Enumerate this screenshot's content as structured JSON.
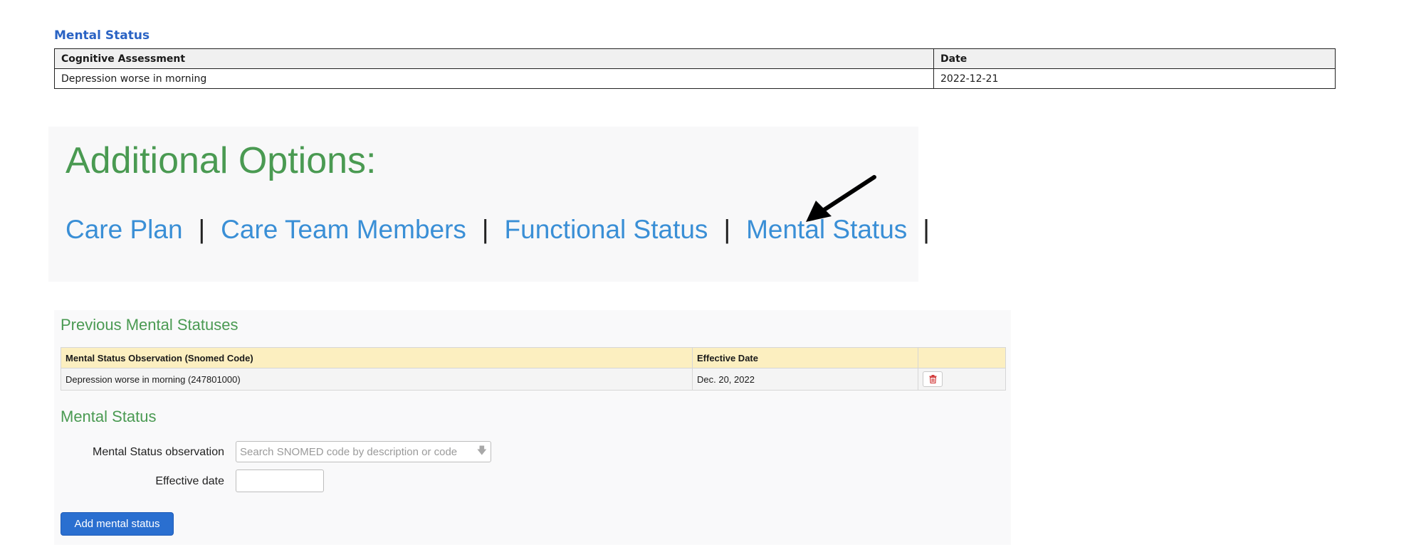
{
  "summary": {
    "title": "Mental Status",
    "headers": [
      "Cognitive Assessment",
      "Date"
    ],
    "rows": [
      [
        "Depression worse in morning",
        "2022-12-21"
      ]
    ]
  },
  "options": {
    "heading": "Additional Options:",
    "links": [
      "Care Plan",
      "Care Team Members",
      "Functional Status",
      "Mental Status"
    ],
    "separator": "|"
  },
  "previous": {
    "heading": "Previous Mental Statuses",
    "headers": [
      "Mental Status Observation (Snomed Code)",
      "Effective Date",
      ""
    ],
    "rows": [
      {
        "observation": "Depression worse in morning (247801000)",
        "date": "Dec. 20, 2022",
        "action_icon": "trash-icon"
      }
    ]
  },
  "form": {
    "heading": "Mental Status",
    "observation_label": "Mental Status observation",
    "observation_placeholder": "Search SNOMED code by description or code",
    "observation_value": "",
    "date_label": "Effective date",
    "date_value": "",
    "submit_label": "Add mental status"
  },
  "colors": {
    "heading_green": "#4a9a52",
    "link_blue": "#3a8fd6",
    "title_blue": "#2a63c4",
    "table_header_yellow": "#fcefc0",
    "primary_button": "#2a6fd0",
    "delete_red": "#d23b3b"
  }
}
